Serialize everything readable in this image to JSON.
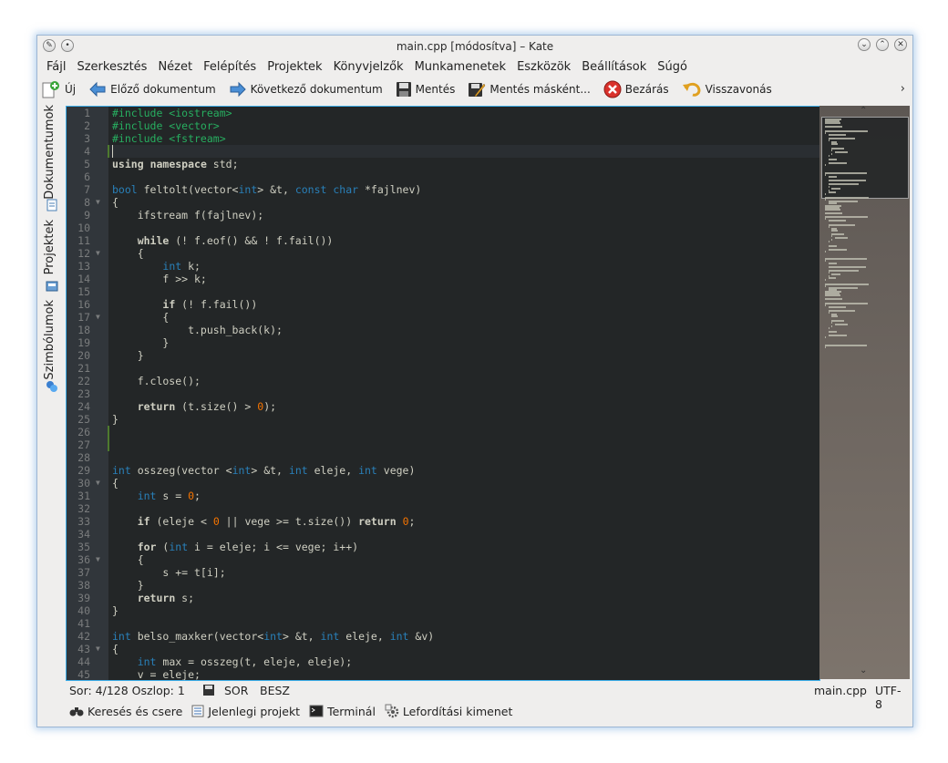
{
  "window": {
    "title": "main.cpp [módosítva] – Kate"
  },
  "menu": [
    "Fájl",
    "Szerkesztés",
    "Nézet",
    "Felépítés",
    "Projektek",
    "Könyvjelzők",
    "Munkamenetek",
    "Eszközök",
    "Beállítások",
    "Súgó"
  ],
  "toolbar": {
    "new": "Új",
    "prev_doc": "Előző dokumentum",
    "next_doc": "Következő dokumentum",
    "save": "Mentés",
    "save_as": "Mentés másként...",
    "close": "Bezárás",
    "undo": "Visszavonás",
    "more": "›"
  },
  "side_tabs": {
    "documents": "Dokumentumok",
    "projects": "Projektek",
    "symbols": "Szimbólumok"
  },
  "code": {
    "lines": [
      "#include <iostream>",
      "#include <vector>",
      "#include <fstream>",
      "",
      "using namespace std;",
      "",
      "bool feltolt(vector<int> &t, const char *fajlnev)",
      "{",
      "    ifstream f(fajlnev);",
      "",
      "    while (! f.eof() && ! f.fail())",
      "    {",
      "        int k;",
      "        f >> k;",
      "",
      "        if (! f.fail())",
      "        {",
      "            t.push_back(k);",
      "        }",
      "    }",
      "",
      "    f.close();",
      "",
      "    return (t.size() > 0);",
      "}",
      "",
      "",
      "",
      "int osszeg(vector <int> &t, int eleje, int vege)",
      "{",
      "    int s = 0;",
      "",
      "    if (eleje < 0 || vege >= t.size()) return 0;",
      "",
      "    for (int i = eleje; i <= vege; i++)",
      "    {",
      "        s += t[i];",
      "    }",
      "    return s;",
      "}",
      "",
      "int belso_maxker(vector<int> &t, int eleje, int &v)",
      "{",
      "    int max = osszeg(t, eleje, eleje);",
      "    v = eleje;"
    ],
    "fold_lines": [
      8,
      12,
      17,
      30,
      36,
      43
    ],
    "current_line": 4
  },
  "status": {
    "position": "Sor: 4/128 Oszlop: 1",
    "mode": "SOR",
    "insert": "BESZ",
    "filename": "main.cpp",
    "encoding": "UTF-8"
  },
  "bottom_tabs": {
    "search": "Keresés és csere",
    "project": "Jelenlegi projekt",
    "terminal": "Terminál",
    "build": "Lefordítási kimenet"
  },
  "colors": {
    "editor_bg": "#232627",
    "gutter_bg": "#31363b",
    "preprocessor": "#27ae60",
    "type": "#2980b9",
    "number": "#f67400",
    "text": "#cfcfc2"
  }
}
